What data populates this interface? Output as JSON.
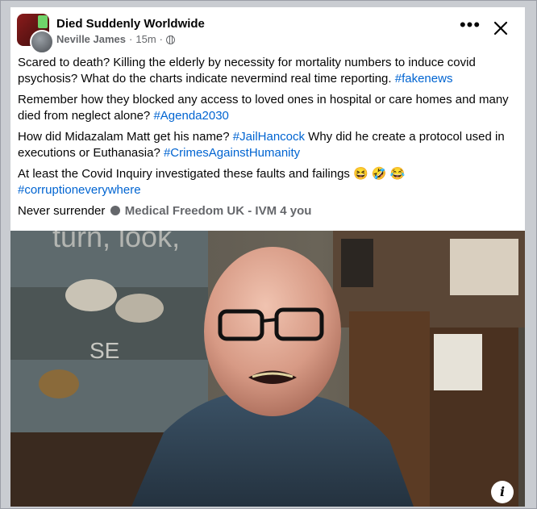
{
  "post": {
    "group_name": "Died Suddenly Worldwide",
    "author": "Neville James",
    "separator": "·",
    "time": "15m",
    "separator2": "·",
    "visibility_icon": "globe-icon",
    "more_label": "•••",
    "close_icon": "close-icon"
  },
  "body": {
    "p1_text": "Scared to death? Killing the elderly by necessity for mortality numbers to induce covid psychosis? What do the charts indicate nevermind real time reporting. ",
    "p1_tag": "#fakenews",
    "p2_text": "Remember how they blocked any access to loved ones in hospital or care homes and many died from neglect alone? ",
    "p2_tag": "#Agenda2030",
    "p3_text_a": "How did Midazalam Matt get his name? ",
    "p3_tag_a": "#JailHancock",
    "p3_text_b": " Why did he create a protocol used in executions or Euthanasia? ",
    "p3_tag_b": "#CrimesAgainstHumanity",
    "p4_text": "At least the Covid Inquiry investigated these faults and failings ",
    "p4_emojis": "😆 🤣 😂",
    "p4_tag": "#corruptioneverywhere",
    "shared_prefix": "Never surrender",
    "shared_source": "Medical Freedom UK - IVM 4 you"
  },
  "media": {
    "background_text": "turn, look,",
    "banner_text": "SE",
    "info_label": "i"
  }
}
